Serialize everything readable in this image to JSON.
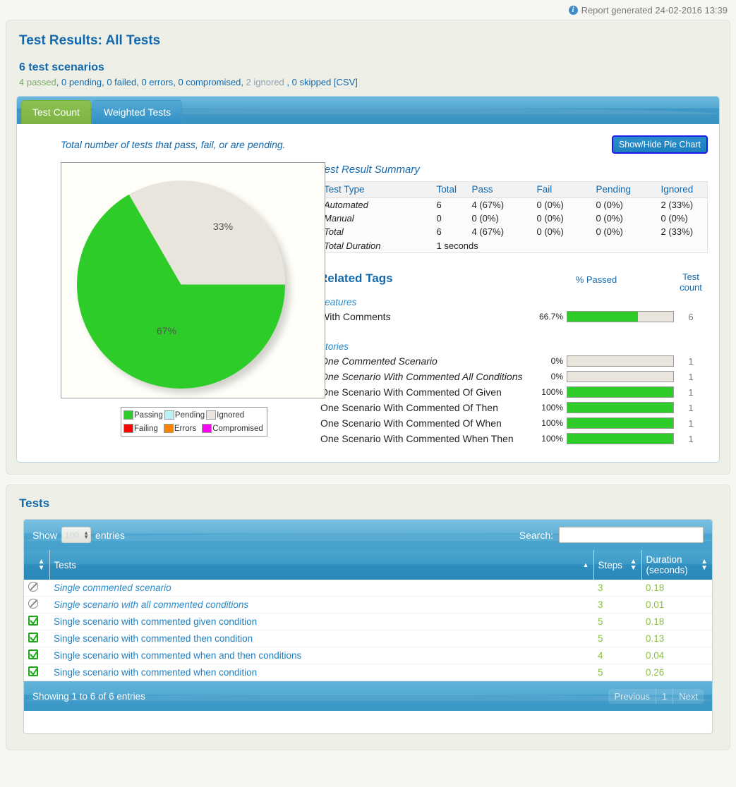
{
  "topbar": {
    "info_icon": "info-icon",
    "generated": "Report generated 24-02-2016 13:39"
  },
  "header": {
    "title": "Test Results: All Tests",
    "subtitle": "6 test scenarios",
    "counts": {
      "passed": "4 passed",
      "rest": ", 0 pending, 0 failed, 0 errors, 0 compromised, ",
      "ignored": "2 ignored",
      "tail": " , 0 skipped ",
      "csv": "[CSV]"
    }
  },
  "tabs": [
    {
      "label": "Test Count",
      "active": true
    },
    {
      "label": "Weighted Tests",
      "active": false
    }
  ],
  "tabpanel": {
    "description": "Total number of tests that pass, fail, or are pending.",
    "pie_button": "Show/Hide Pie Chart"
  },
  "chart_data": {
    "type": "pie",
    "title": "Total number of tests that pass, fail, or are pending.",
    "categories": [
      "Passing",
      "Ignored"
    ],
    "values": [
      67,
      33
    ],
    "labels": [
      "67%",
      "33%"
    ],
    "colors": [
      "#2ecc28",
      "#e9e5dc"
    ],
    "legend_position": "bottom",
    "legend": [
      {
        "label": "Passing",
        "color": "#2ecc28"
      },
      {
        "label": "Pending",
        "color": "#b8f2f7"
      },
      {
        "label": "Ignored",
        "color": "#e9e5dc"
      },
      {
        "label": "Failing",
        "color": "#fa0505"
      },
      {
        "label": "Errors",
        "color": "#fa8205"
      },
      {
        "label": "Compromised",
        "color": "#fa05f0"
      }
    ]
  },
  "summary": {
    "title": "Test Result Summary",
    "columns": [
      "Test Type",
      "Total",
      "Pass",
      "Fail",
      "Pending",
      "Ignored"
    ],
    "rows": [
      {
        "type": "Automated",
        "total": "6",
        "pass": "4 (67%)",
        "fail": "0 (0%)",
        "pending": "0 (0%)",
        "ignored": "2 (33%)"
      },
      {
        "type": "Manual",
        "total": "0",
        "pass": "0 (0%)",
        "fail": "0 (0%)",
        "pending": "0 (0%)",
        "ignored": "0 (0%)"
      },
      {
        "type": "Total",
        "total": "6",
        "pass": "4 (67%)",
        "fail": "0 (0%)",
        "pending": "0 (0%)",
        "ignored": "2 (33%)"
      }
    ],
    "duration_label": "Total Duration",
    "duration_value": "1 seconds"
  },
  "related_tags": {
    "title": "Related Tags",
    "pct_header": "% Passed",
    "count_header_line1": "Test",
    "count_header_line2": "count",
    "groups": [
      {
        "name": "Features",
        "rows": [
          {
            "name": "With Comments",
            "pct": "66.7%",
            "fill": 66.7,
            "count": "6",
            "italic": false
          }
        ]
      },
      {
        "name": "Stories",
        "rows": [
          {
            "name": "One Commented Scenario",
            "pct": "0%",
            "fill": 0,
            "count": "1",
            "italic": true
          },
          {
            "name": "One Scenario With Commented All Conditions",
            "pct": "0%",
            "fill": 0,
            "count": "1",
            "italic": true
          },
          {
            "name": "One Scenario With Commented Of Given",
            "pct": "100%",
            "fill": 100,
            "count": "1",
            "italic": false
          },
          {
            "name": "One Scenario With Commented Of Then",
            "pct": "100%",
            "fill": 100,
            "count": "1",
            "italic": false
          },
          {
            "name": "One Scenario With Commented Of When",
            "pct": "100%",
            "fill": 100,
            "count": "1",
            "italic": false
          },
          {
            "name": "One Scenario With Commented When Then",
            "pct": "100%",
            "fill": 100,
            "count": "1",
            "italic": false
          }
        ]
      }
    ]
  },
  "tests": {
    "title": "Tests",
    "show_label": "Show",
    "entries_label": "entries",
    "page_size": "100",
    "search_label": "Search:",
    "search_value": "",
    "columns": [
      "",
      "Tests",
      "Steps",
      "Duration (seconds)"
    ],
    "duration_header_line1": "Duration",
    "duration_header_line2": "(seconds)",
    "rows": [
      {
        "status": "ignored",
        "name": "Single commented scenario",
        "steps": "3",
        "duration": "0.18"
      },
      {
        "status": "ignored",
        "name": "Single scenario with all commented conditions",
        "steps": "3",
        "duration": "0.01"
      },
      {
        "status": "passed",
        "name": "Single scenario with commented given condition",
        "steps": "5",
        "duration": "0.18"
      },
      {
        "status": "passed",
        "name": "Single scenario with commented then condition",
        "steps": "5",
        "duration": "0.13"
      },
      {
        "status": "passed",
        "name": "Single scenario with commented when and then conditions",
        "steps": "4",
        "duration": "0.04"
      },
      {
        "status": "passed",
        "name": "Single scenario with commented when condition",
        "steps": "5",
        "duration": "0.26"
      }
    ],
    "info": "Showing 1 to 6 of 6 entries",
    "pager": [
      "Previous",
      "1",
      "Next"
    ]
  },
  "colors": {
    "brand_blue": "#1268ac",
    "pass_green": "#2ecc28",
    "ignored_grey": "#e9e5dc",
    "tab_active": "#8cc152",
    "table_header": "#3e9bc8"
  }
}
